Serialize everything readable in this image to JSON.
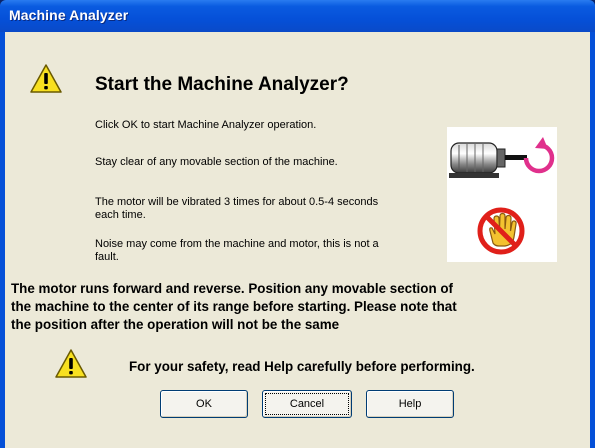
{
  "window": {
    "title": "Machine Analyzer"
  },
  "dialog": {
    "heading": "Start the Machine Analyzer?",
    "lines": [
      "Click OK to start Machine Analyzer operation.",
      "Stay clear of any movable section of the machine.",
      "The motor will be vibrated 3 times for about 0.5-4 seconds",
      "each time.",
      "Noise may come from the machine and motor, this is not a",
      "fault."
    ],
    "warning_lines": [
      "The motor runs forward and reverse. Position any movable section of",
      "the machine to the center of its range before starting. Please note that",
      "the position after the operation will not be the same"
    ],
    "safety_note": "For your safety, read Help carefully before performing.",
    "icons": {
      "top": "warning-icon",
      "bottom": "warning-icon",
      "motor": "motor-rotation-icon",
      "no_touch": "no-touch-hand-icon"
    }
  },
  "buttons": {
    "ok": "OK",
    "cancel": "Cancel",
    "help": "Help"
  },
  "colors": {
    "titlebar": "#0550d8",
    "client": "#ece9d8",
    "rotation_arrow": "#e0308c",
    "prohibit_red": "#e0201a"
  }
}
